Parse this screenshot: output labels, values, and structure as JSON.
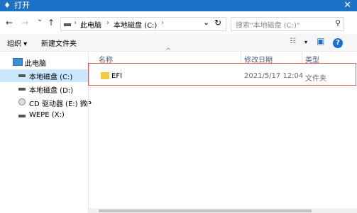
{
  "window": {
    "title": "打开",
    "close_glyph": "✕",
    "app_icon": "♦"
  },
  "nav": {
    "back_glyph": "←",
    "forward_glyph": "→",
    "recent_glyph": "⌄",
    "up_glyph": "↑"
  },
  "address": {
    "crumbs": [
      "此电脑",
      "本地磁盘 (C:)"
    ],
    "separator": "›",
    "dropdown_glyph": "⌄",
    "refresh_glyph": "↻"
  },
  "search": {
    "placeholder": "搜索\"本地磁盘 (C:)\"",
    "icon_glyph": "⚲"
  },
  "toolbar": {
    "organize": "组织 ▾",
    "new_folder": "新建文件夹",
    "view_glyph": "☷",
    "view_dropdown": "▾",
    "pane_glyph": "▣",
    "help_glyph": "?"
  },
  "sidebar": {
    "items": [
      {
        "label": "此电脑",
        "icon": "pc-icon"
      },
      {
        "label": "本地磁盘 (C:)",
        "icon": "drive-icon",
        "selected": true
      },
      {
        "label": "本地磁盘 (D:)",
        "icon": "drive-icon"
      },
      {
        "label": "CD 驱动器 (E:) 微P",
        "icon": "cd-drive-icon"
      },
      {
        "label": "WEPE (X:)",
        "icon": "drive-icon"
      }
    ]
  },
  "columns": {
    "name": "名称",
    "modified": "修改日期",
    "type": "类型",
    "sort_caret": "^"
  },
  "files": [
    {
      "name": "EFI",
      "modified": "2021/5/17 12:04",
      "type": "文件夹",
      "icon": "folder-icon"
    }
  ],
  "colors": {
    "titlebar": "#1a73c9",
    "selection": "#cce8ff",
    "highlight_box": "#e4575b",
    "folder": "#f3c846"
  }
}
